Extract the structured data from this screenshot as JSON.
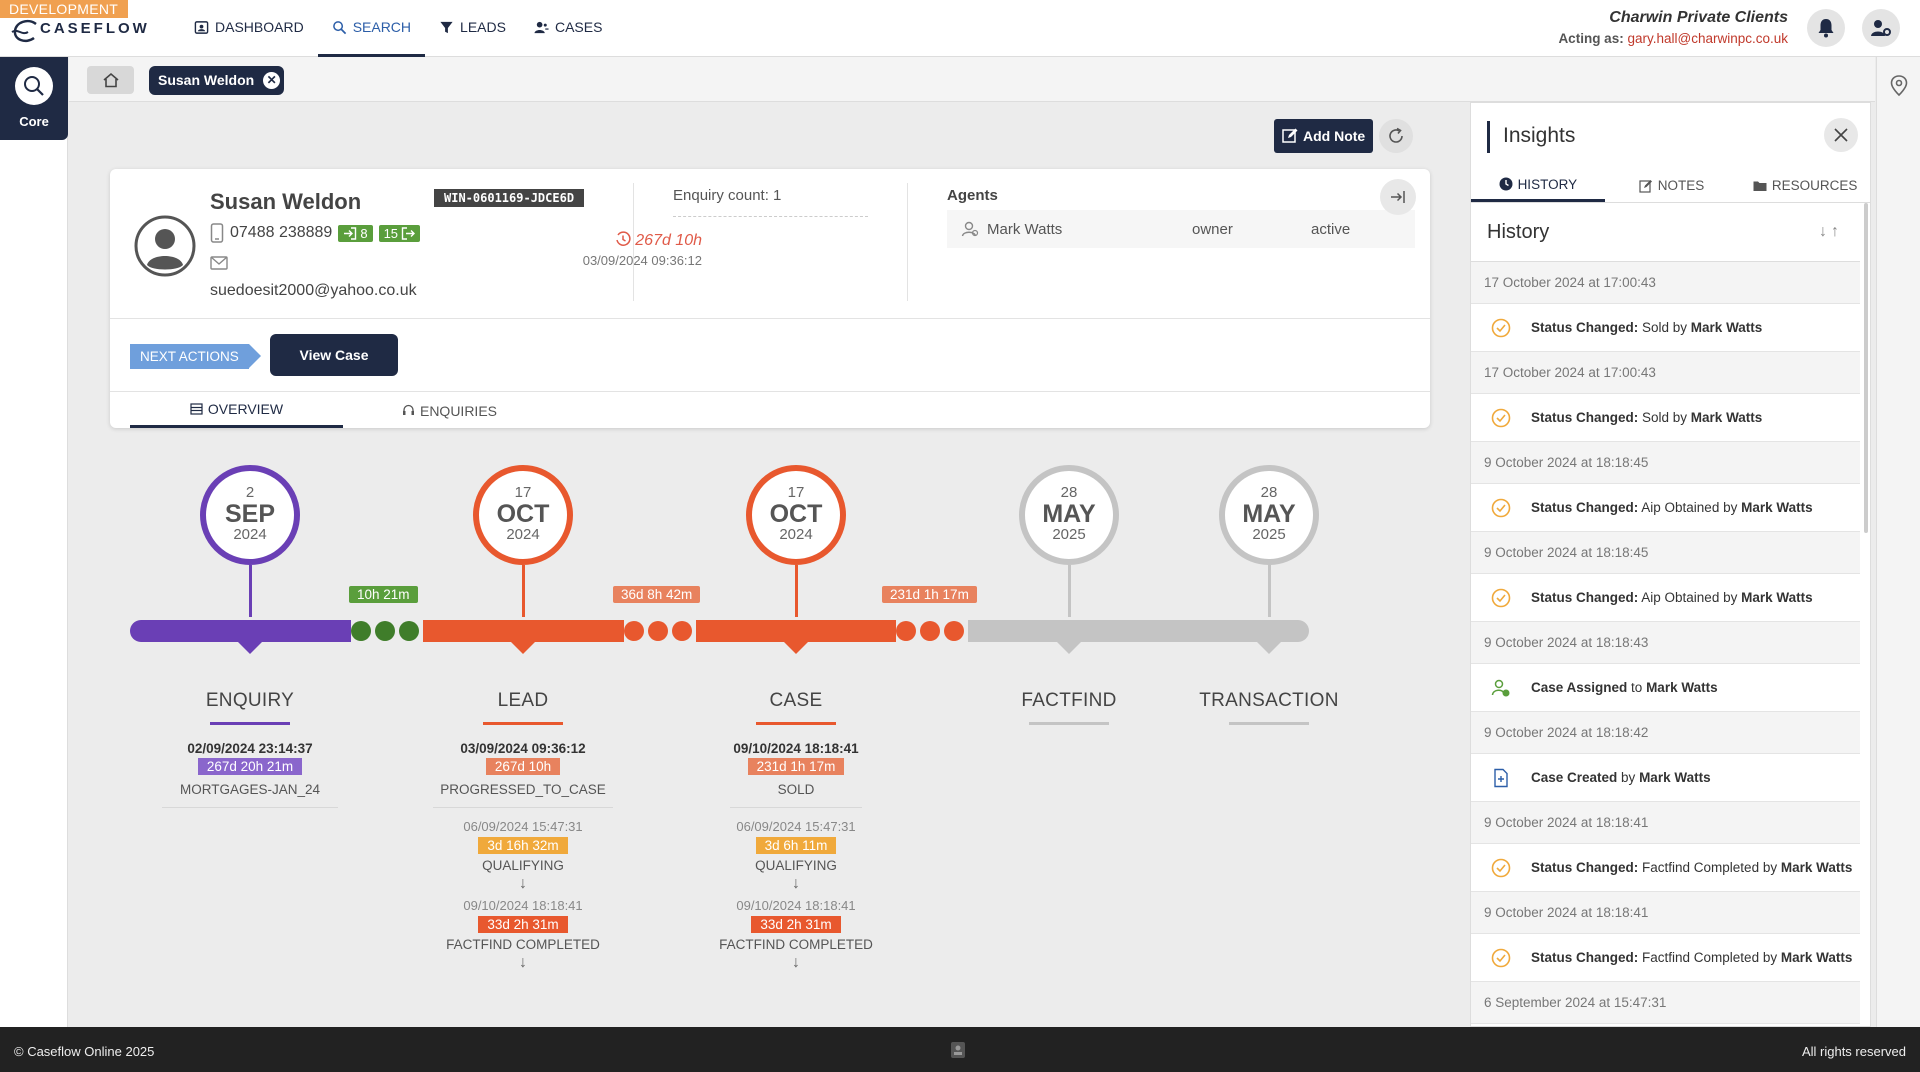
{
  "env_badge": "DEVELOPMENT",
  "brand": "CASEFLOW",
  "nav": [
    {
      "label": "DASHBOARD",
      "icon": "dashboard-icon"
    },
    {
      "label": "SEARCH",
      "icon": "search-icon"
    },
    {
      "label": "LEADS",
      "icon": "filter-icon"
    },
    {
      "label": "CASES",
      "icon": "users-icon"
    }
  ],
  "org": {
    "name": "Charwin Private Clients",
    "acting_label": "Acting as:",
    "acting_email": "gary.hall@charwinpc.co.uk"
  },
  "sidebar": {
    "core_label": "Core"
  },
  "tabs": {
    "person_tab": "Susan Weldon",
    "close_glyph": "✕"
  },
  "actions": {
    "add_note": "Add Note"
  },
  "person": {
    "name": "Susan Weldon",
    "ref": "WIN-0601169-JDCE6D",
    "phone": "07488 238889",
    "in_count": "8",
    "out_count": "15",
    "email": "suedoesit2000@yahoo.co.uk",
    "age": "267d 10h",
    "created": "03/09/2024 09:36:12",
    "enquiry_count": "Enquiry count: 1",
    "agents_title": "Agents",
    "agent": {
      "name": "Mark Watts",
      "role": "owner",
      "status": "active"
    },
    "next_actions": "NEXT ACTIONS",
    "view_case": "View Case",
    "tab_overview": "OVERVIEW",
    "tab_enquiries": "ENQUIRIES"
  },
  "milestones": [
    {
      "day": "2",
      "month": "SEP",
      "year": "2024",
      "color": "#6a3fb5"
    },
    {
      "day": "17",
      "month": "OCT",
      "year": "2024",
      "color": "#e8582e"
    },
    {
      "day": "17",
      "month": "OCT",
      "year": "2024",
      "color": "#e8582e"
    },
    {
      "day": "28",
      "month": "MAY",
      "year": "2025",
      "color": "#c4c4c4"
    },
    {
      "day": "28",
      "month": "MAY",
      "year": "2025",
      "color": "#c4c4c4"
    }
  ],
  "gaps": [
    "10h 21m",
    "36d 8h 42m",
    "231d 1h 17m"
  ],
  "stages": {
    "enquiry": {
      "name": "ENQUIRY",
      "date": "02/09/2024 23:14:37",
      "duration": "267d 20h 21m",
      "status": "MORTGAGES-JAN_24"
    },
    "lead": {
      "name": "LEAD",
      "date": "03/09/2024 09:36:12",
      "duration": "267d 10h",
      "status": "PROGRESSED_TO_CASE",
      "history": [
        {
          "date": "06/09/2024 15:47:31",
          "duration": "3d 16h 32m",
          "status": "QUALIFYING"
        },
        {
          "date": "09/10/2024 18:18:41",
          "duration": "33d 2h 31m",
          "status": "FACTFIND COMPLETED"
        }
      ]
    },
    "case": {
      "name": "CASE",
      "date": "09/10/2024 18:18:41",
      "duration": "231d 1h 17m",
      "status": "SOLD",
      "history": [
        {
          "date": "06/09/2024 15:47:31",
          "duration": "3d 6h 11m",
          "status": "QUALIFYING"
        },
        {
          "date": "09/10/2024 18:18:41",
          "duration": "33d 2h 31m",
          "status": "FACTFIND COMPLETED"
        }
      ]
    },
    "factfind": {
      "name": "FACTFIND"
    },
    "transaction": {
      "name": "TRANSACTION"
    }
  },
  "arrow_glyph": "↓",
  "insights": {
    "title": "Insights",
    "tabs": [
      "HISTORY",
      "NOTES",
      "RESOURCES"
    ],
    "history_title": "History",
    "sort_glyphs": "↓↑",
    "events": [
      {
        "date": "17 October 2024 at 17:00:43",
        "icon": "check-circle-icon",
        "action": "Status Changed:",
        "detail": " Sold by ",
        "who": "Mark Watts"
      },
      {
        "date": "17 October 2024 at 17:00:43",
        "icon": "check-circle-icon",
        "action": "Status Changed:",
        "detail": " Sold by ",
        "who": "Mark Watts"
      },
      {
        "date": "9 October 2024 at 18:18:45",
        "icon": "check-circle-icon",
        "action": "Status Changed:",
        "detail": " Aip Obtained by ",
        "who": "Mark Watts"
      },
      {
        "date": "9 October 2024 at 18:18:45",
        "icon": "check-circle-icon",
        "action": "Status Changed:",
        "detail": " Aip Obtained by ",
        "who": "Mark Watts"
      },
      {
        "date": "9 October 2024 at 18:18:43",
        "icon": "user-assign-icon",
        "action": "Case Assigned",
        "detail": " to ",
        "who": "Mark Watts"
      },
      {
        "date": "9 October 2024 at 18:18:42",
        "icon": "file-plus-icon",
        "action": "Case Created",
        "detail": " by ",
        "who": "Mark Watts"
      },
      {
        "date": "9 October 2024 at 18:18:41",
        "icon": "check-circle-icon",
        "action": "Status Changed:",
        "detail": " Factfind Completed by ",
        "who": "Mark Watts"
      },
      {
        "date": "9 October 2024 at 18:18:41",
        "icon": "check-circle-icon",
        "action": "Status Changed:",
        "detail": " Factfind Completed by ",
        "who": "Mark Watts"
      }
    ],
    "last_date": "6 September 2024 at 15:47:31"
  },
  "footer": {
    "left": "© Caseflow Online 2025",
    "right": "All rights reserved"
  }
}
